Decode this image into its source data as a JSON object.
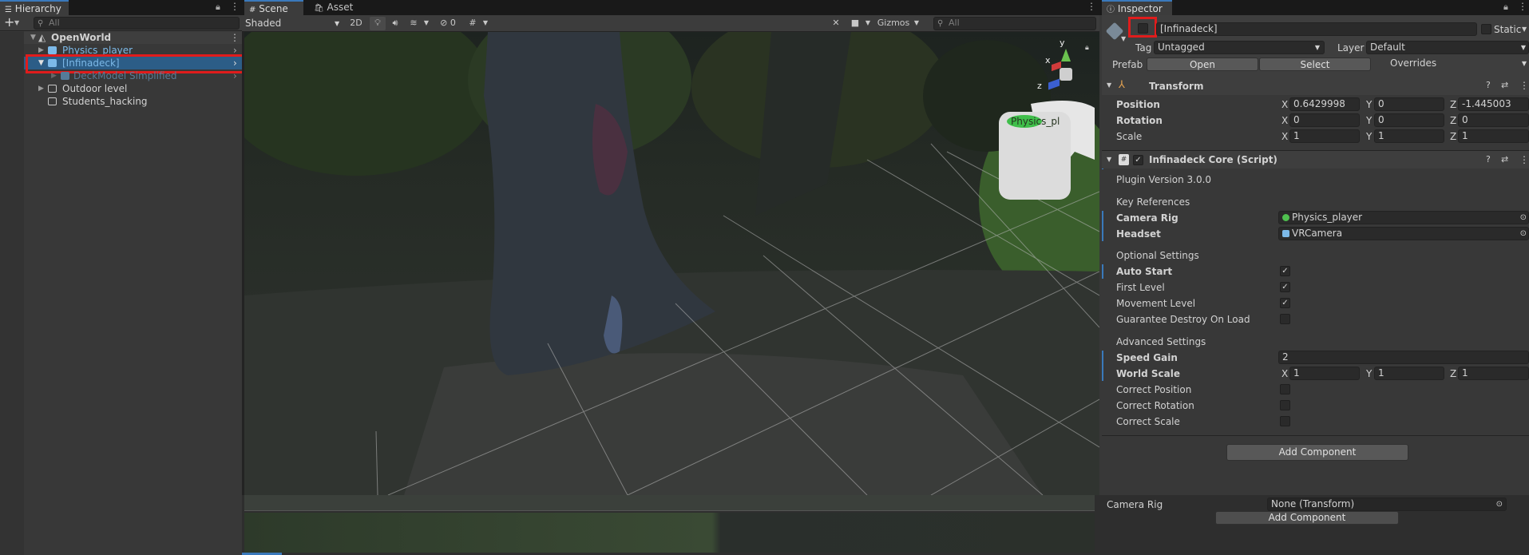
{
  "hierarchy": {
    "tab_label": "Hierarchy",
    "add_label": "+",
    "search_placeholder": "All",
    "scene_name": "OpenWorld",
    "items": [
      {
        "label": "Physics_player"
      },
      {
        "label": "[Infinadeck]"
      },
      {
        "label": "DeckModel Simplified"
      },
      {
        "label": "Outdoor level"
      },
      {
        "label": "Students_hacking"
      }
    ]
  },
  "scene": {
    "tabs": [
      {
        "label": "Scene"
      },
      {
        "label": "Asset Store"
      }
    ],
    "shading_mode": "Shaded",
    "mode_2d": "2D",
    "hidden_count": "0",
    "gizmos_label": "Gizmos",
    "search_placeholder": "All",
    "gizmo_axes": {
      "y": "y",
      "x": "x",
      "z": "z"
    },
    "overlay_label": "Physics_pl"
  },
  "inspector": {
    "tab_label": "Inspector",
    "object_name": "[Infinadeck]",
    "static_label": "Static",
    "tag_label": "Tag",
    "tag_value": "Untagged",
    "layer_label": "Layer",
    "layer_value": "Default",
    "prefab_label": "Prefab",
    "prefab_open": "Open",
    "prefab_select": "Select",
    "prefab_overrides": "Overrides",
    "transform": {
      "title": "Transform",
      "position_label": "Position",
      "rotation_label": "Rotation",
      "scale_label": "Scale",
      "axis_x": "X",
      "axis_y": "Y",
      "axis_z": "Z",
      "position": {
        "x": "0.6429998",
        "y": "0",
        "z": "-1.445003"
      },
      "rotation": {
        "x": "0",
        "y": "0",
        "z": "0"
      },
      "scale": {
        "x": "1",
        "y": "1",
        "z": "1"
      }
    },
    "core": {
      "title": "Infinadeck Core (Script)",
      "plugin_version": "Plugin Version 3.0.0",
      "key_references": "Key References",
      "camera_rig_label": "Camera Rig",
      "camera_rig_value": "Physics_player",
      "headset_label": "Headset",
      "headset_value": "VRCamera",
      "optional_settings": "Optional Settings",
      "auto_start": "Auto Start",
      "first_level": "First Level",
      "movement_level": "Movement Level",
      "guarantee_destroy": "Guarantee Destroy On Load",
      "advanced_settings": "Advanced Settings",
      "speed_gain_label": "Speed Gain",
      "speed_gain_value": "2",
      "world_scale_label": "World Scale",
      "world_scale": {
        "x": "1",
        "y": "1",
        "z": "1"
      },
      "correct_position": "Correct Position",
      "correct_rotation": "Correct Rotation",
      "correct_scale": "Correct Scale",
      "checks": {
        "auto_start": true,
        "first_level": true,
        "movement_level": true,
        "guarantee_destroy": false,
        "correct_position": false,
        "correct_rotation": false,
        "correct_scale": false
      }
    },
    "add_component": "Add Component",
    "ghost_camera_rig_label": "Camera Rig",
    "ghost_camera_rig_value": "None (Transform)",
    "ghost_add_component": "Add Component"
  },
  "colors": {
    "selection": "#2c5d87",
    "accent": "#3a79bb",
    "highlight_box": "#e01c1c",
    "prefab_blue": "#7cb9e8"
  }
}
